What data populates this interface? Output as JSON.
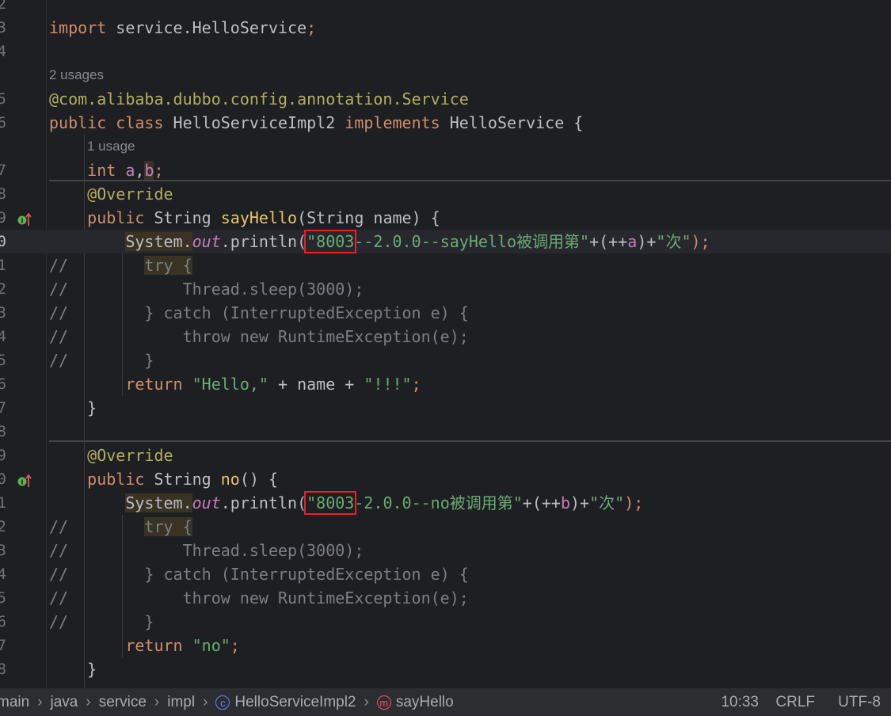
{
  "editor": {
    "colors": {
      "background": "#1E1F22",
      "keyword": "#CF8E6D",
      "annotation": "#B3AE60",
      "string": "#6AAB73",
      "field": "#C77DBB",
      "comment": "#7A7E85",
      "highlight_box": "#E8202A"
    },
    "rows": [
      {
        "ln": "2",
        "tokens": []
      },
      {
        "ln": "3",
        "tokens": [
          [
            "import ",
            "kw"
          ],
          [
            "service.HelloService",
            "txt"
          ],
          [
            ";",
            "kw"
          ]
        ]
      },
      {
        "ln": "4",
        "tokens": []
      },
      {
        "ln": "",
        "hint": "2 usages",
        "indent": 0
      },
      {
        "ln": "5",
        "tokens": [
          [
            "@com.alibaba.dubbo.config.annotation.",
            "ann"
          ],
          [
            "Service",
            "ann"
          ]
        ]
      },
      {
        "ln": "6",
        "tokens": [
          [
            "public ",
            "kw"
          ],
          [
            "class ",
            "kw"
          ],
          [
            "HelloServiceImpl2 ",
            "txt"
          ],
          [
            "implements ",
            "kw"
          ],
          [
            "HelloService {",
            "txt"
          ]
        ]
      },
      {
        "ln": "",
        "hint": "1 usage",
        "indent": 4
      },
      {
        "ln": "7",
        "tokens": [
          [
            "    ",
            "txt"
          ],
          [
            "int ",
            "kw"
          ],
          [
            "a",
            "var"
          ],
          [
            ",",
            "txt"
          ],
          [
            "b",
            "var hl"
          ],
          [
            ";",
            "kw"
          ]
        ]
      },
      {
        "ln": "8",
        "tokens": [
          [
            "    ",
            "txt"
          ],
          [
            "@Override",
            "ann"
          ]
        ]
      },
      {
        "ln": "9",
        "icon": "implements-interface-icon",
        "tokens": [
          [
            "    ",
            "txt"
          ],
          [
            "public ",
            "kw"
          ],
          [
            "String ",
            "txt"
          ],
          [
            "sayHello",
            "fn"
          ],
          [
            "(String name) {",
            "txt"
          ]
        ]
      },
      {
        "ln": "0",
        "current": true,
        "tokens": [
          [
            "        ",
            "txt"
          ],
          [
            "System.",
            "txt hl"
          ],
          [
            "out",
            "fld"
          ],
          [
            ".println(",
            "txt"
          ],
          [
            "\"8003",
            "str boxed"
          ],
          [
            "--2.0.0--sayHello被调用第\"",
            "str"
          ],
          [
            "+(++",
            "txt"
          ],
          [
            "a",
            "var"
          ],
          [
            ")+",
            "txt"
          ],
          [
            "\"次\"",
            "str"
          ],
          [
            ");",
            "kw"
          ]
        ]
      },
      {
        "ln": "1",
        "tokens": [
          [
            "//",
            "cmt"
          ],
          [
            "        ",
            "cmt"
          ],
          [
            "try {",
            "cmt hl"
          ]
        ]
      },
      {
        "ln": "2",
        "tokens": [
          [
            "//            Thread.sleep(3000);",
            "cmt"
          ]
        ]
      },
      {
        "ln": "3",
        "tokens": [
          [
            "//        } catch (InterruptedException e) {",
            "cmt"
          ]
        ]
      },
      {
        "ln": "4",
        "tokens": [
          [
            "//            throw new RuntimeException(e);",
            "cmt"
          ]
        ]
      },
      {
        "ln": "5",
        "tokens": [
          [
            "//        }",
            "cmt"
          ]
        ]
      },
      {
        "ln": "6",
        "tokens": [
          [
            "        ",
            "txt"
          ],
          [
            "return ",
            "kw"
          ],
          [
            "\"Hello,\"",
            "str"
          ],
          [
            " + name + ",
            "txt"
          ],
          [
            "\"!!!\"",
            "str"
          ],
          [
            ";",
            "kw"
          ]
        ]
      },
      {
        "ln": "7",
        "tokens": [
          [
            "    }",
            "txt"
          ]
        ]
      },
      {
        "ln": "8",
        "tokens": []
      },
      {
        "ln": "9",
        "tokens": [
          [
            "    ",
            "txt"
          ],
          [
            "@Override",
            "ann"
          ]
        ]
      },
      {
        "ln": "0",
        "icon": "implements-interface-icon",
        "tokens": [
          [
            "    ",
            "txt"
          ],
          [
            "public ",
            "kw"
          ],
          [
            "String ",
            "txt"
          ],
          [
            "no",
            "fn"
          ],
          [
            "() {",
            "txt"
          ]
        ]
      },
      {
        "ln": "1",
        "tokens": [
          [
            "        ",
            "txt"
          ],
          [
            "System.",
            "txt hl"
          ],
          [
            "out",
            "fld"
          ],
          [
            ".println(",
            "txt"
          ],
          [
            "\"8003",
            "str boxed"
          ],
          [
            "-2.0.0--no被调用第\"",
            "str"
          ],
          [
            "+(++",
            "txt"
          ],
          [
            "b",
            "var"
          ],
          [
            ")+",
            "txt"
          ],
          [
            "\"次\"",
            "str"
          ],
          [
            ");",
            "kw"
          ]
        ]
      },
      {
        "ln": "2",
        "tokens": [
          [
            "//",
            "cmt"
          ],
          [
            "        ",
            "cmt"
          ],
          [
            "try {",
            "cmt hl"
          ]
        ]
      },
      {
        "ln": "3",
        "tokens": [
          [
            "//            Thread.sleep(3000);",
            "cmt"
          ]
        ]
      },
      {
        "ln": "4",
        "tokens": [
          [
            "//        } catch (InterruptedException e) {",
            "cmt"
          ]
        ]
      },
      {
        "ln": "5",
        "tokens": [
          [
            "//            throw new RuntimeException(e);",
            "cmt"
          ]
        ]
      },
      {
        "ln": "6",
        "tokens": [
          [
            "//        }",
            "cmt"
          ]
        ]
      },
      {
        "ln": "7",
        "tokens": [
          [
            "        ",
            "txt"
          ],
          [
            "return ",
            "kw"
          ],
          [
            "\"no\"",
            "str"
          ],
          [
            ";",
            "kw"
          ]
        ]
      },
      {
        "ln": "8",
        "tokens": [
          [
            "    }",
            "txt"
          ]
        ]
      }
    ]
  },
  "status": {
    "breadcrumb": [
      {
        "label": "main"
      },
      {
        "label": "java"
      },
      {
        "label": "service"
      },
      {
        "label": "impl"
      },
      {
        "label": "HelloServiceImpl2",
        "icon": "class-icon",
        "icon_glyph": "c",
        "icon_color": "#548AF7"
      },
      {
        "label": "sayHello",
        "icon": "method-icon",
        "icon_glyph": "m",
        "icon_color": "#F75464"
      }
    ],
    "position": "10:33",
    "line_ending": "CRLF",
    "encoding": "UTF-8"
  }
}
